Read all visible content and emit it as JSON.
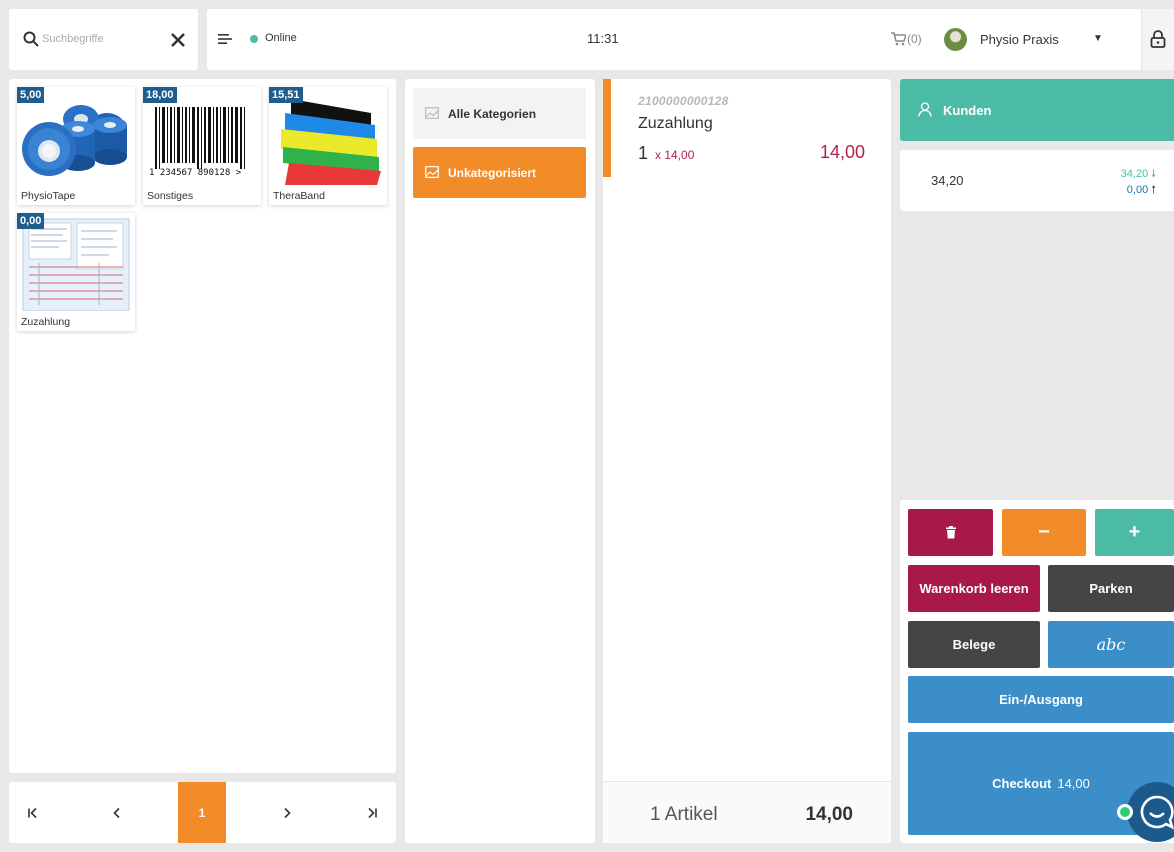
{
  "search": {
    "placeholder": "Suchbegriffe",
    "icon": "search-icon",
    "clear_icon": "close-icon"
  },
  "header": {
    "status": "Online",
    "status_color": "#4cbba5",
    "clock": "11:31",
    "cart_count": "(0)",
    "user": "Physio Praxis"
  },
  "products": [
    {
      "name": "PhysioTape",
      "price": "5,00"
    },
    {
      "name": "Sonstiges",
      "price": "18,00",
      "barcode_text": "1 234567 890128 >"
    },
    {
      "name": "TheraBand",
      "price": "15,51"
    },
    {
      "name": "Zuzahlung",
      "price": "0,00"
    }
  ],
  "pager": {
    "first": "|<",
    "prev": "<",
    "current": "1",
    "next": ">",
    "last": ">|"
  },
  "categories": [
    {
      "label": "Alle Kategorien",
      "active": false
    },
    {
      "label": "Unkategorisiert",
      "active": true
    }
  ],
  "cart": {
    "item": {
      "code": "2100000000128",
      "name": "Zuzahlung",
      "qty": "1",
      "unit": "x 14,00",
      "total": "14,00"
    },
    "count_label": "1 Artikel",
    "sum": "14,00"
  },
  "customer": {
    "label": "Kunden"
  },
  "balance": {
    "main": "34,20",
    "in": "34,20",
    "out": "0,00"
  },
  "actions": {
    "delete_icon": "trash-icon",
    "minus": "−",
    "plus": "+",
    "clear_cart": "Warenkorb leeren",
    "park": "Parken",
    "receipts": "Belege",
    "abc": "abc",
    "in_out": "Ein-/Ausgang",
    "checkout": "Checkout",
    "checkout_total": "14,00"
  },
  "colors": {
    "accent_orange": "#f28c28",
    "accent_green": "#4cbba5",
    "accent_red": "#a8194a",
    "accent_blue": "#3b8ec7",
    "price_badge": "#1e5d8e"
  }
}
